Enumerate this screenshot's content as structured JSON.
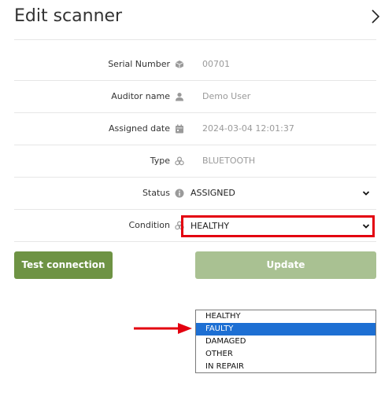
{
  "header": {
    "title": "Edit scanner"
  },
  "fields": {
    "serial_number": {
      "label": "Serial Number",
      "value": "00701",
      "icon": "cube-icon"
    },
    "auditor_name": {
      "label": "Auditor name",
      "value": "Demo User",
      "icon": "user-icon"
    },
    "assigned_date": {
      "label": "Assigned date",
      "value": "2024-03-04 12:01:37",
      "icon": "calendar-icon"
    },
    "type": {
      "label": "Type",
      "value": "BLUETOOTH",
      "icon": "cubes-icon"
    },
    "status": {
      "label": "Status",
      "value": "ASSIGNED",
      "icon": "info-icon"
    },
    "condition": {
      "label": "Condition",
      "value": "HEALTHY",
      "icon": "cubes-icon"
    }
  },
  "buttons": {
    "test_connection": "Test connection",
    "update": "Update"
  },
  "condition_dropdown": {
    "options": [
      "HEALTHY",
      "FAULTY",
      "DAMAGED",
      "OTHER",
      "IN REPAIR"
    ],
    "highlighted": "FAULTY"
  },
  "colors": {
    "primary_green": "#6e9344",
    "disabled_green": "#a9c192",
    "highlight_red": "#e3000f",
    "selection_blue": "#1d6fd3"
  }
}
